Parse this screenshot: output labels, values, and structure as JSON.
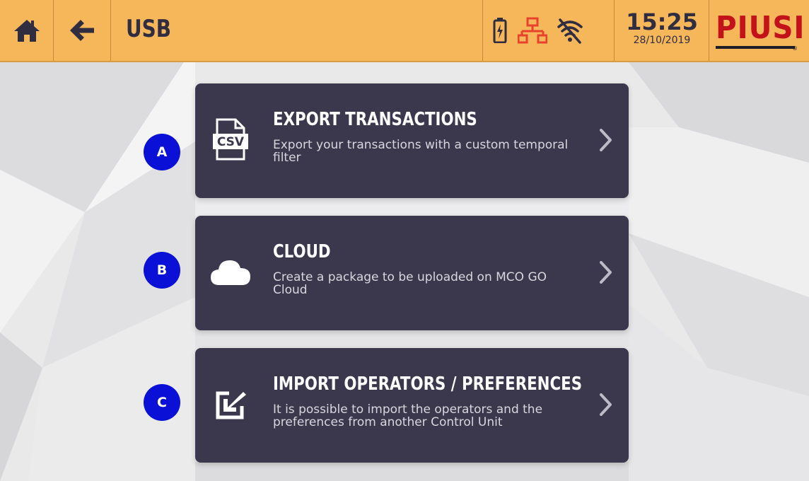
{
  "header": {
    "title": "USB",
    "time": "15:25",
    "date": "28/10/2019",
    "logo_text": "PIUSI",
    "icons": [
      "home-icon",
      "back-arrow-icon",
      "battery-charging-icon",
      "network-icon",
      "wifi-off-icon"
    ]
  },
  "colors": {
    "header_bg": "#f6b75b",
    "card_bg": "#3b374d",
    "marker_bg": "#0a10d6",
    "logo_red": "#c4121a",
    "network_icon": "#e8412c"
  },
  "menu": [
    {
      "marker": "A",
      "icon": "csv-file-icon",
      "icon_label": "CSV",
      "title": "EXPORT TRANSACTIONS",
      "description": "Export your transactions with a custom temporal filter"
    },
    {
      "marker": "B",
      "icon": "cloud-icon",
      "title": "CLOUD",
      "description": "Create a package to be uploaded on MCO GO Cloud"
    },
    {
      "marker": "C",
      "icon": "import-icon",
      "title": "IMPORT OPERATORS / PREFERENCES",
      "description": "It is possible to import the operators and the preferences from another Control Unit"
    }
  ]
}
